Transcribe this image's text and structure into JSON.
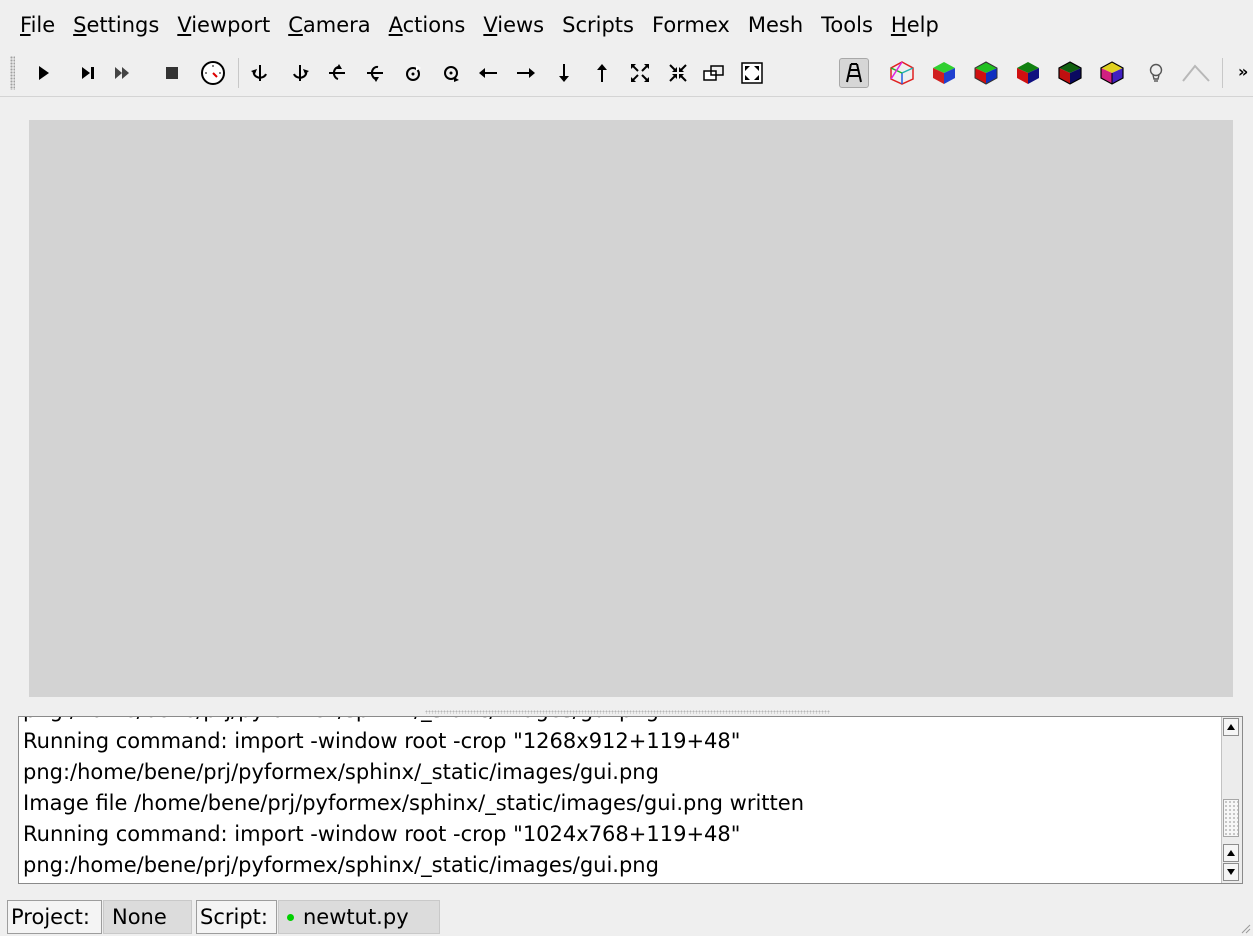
{
  "menubar": {
    "items": [
      {
        "first": "F",
        "rest": "ile"
      },
      {
        "first": "S",
        "rest": "ettings"
      },
      {
        "first": "V",
        "rest": "iewport"
      },
      {
        "first": "C",
        "rest": "amera"
      },
      {
        "first": "A",
        "rest": "ctions"
      },
      {
        "first": "V",
        "rest": "iews"
      },
      {
        "first": "",
        "rest": "Scripts"
      },
      {
        "first": "",
        "rest": "Formex"
      },
      {
        "first": "",
        "rest": "Mesh"
      },
      {
        "first": "",
        "rest": "Tools"
      },
      {
        "first": "H",
        "rest": "elp"
      }
    ]
  },
  "toolbar": {
    "icons": [
      "play-icon",
      "step-icon",
      "continue-icon",
      "stop-icon",
      "timer-icon",
      "rotate-left-icon",
      "rotate-right-icon",
      "rotate-up-icon",
      "rotate-down-icon",
      "rotate-ccw-icon",
      "rotate-cw-icon",
      "pan-left-icon",
      "pan-right-icon",
      "pan-down-icon",
      "pan-up-icon",
      "zoom-in-icon",
      "zoom-out-icon",
      "zoom-rectangle-icon",
      "zoom-all-icon",
      "perspective-icon",
      "wireframe-icon",
      "smooth-icon",
      "flat-icon",
      "smoothwire-icon",
      "flatwire-icon",
      "transparency-icon",
      "light-icon",
      "shrink-icon"
    ],
    "more_label": "»"
  },
  "messages": {
    "lines": [
      "png:/home/bene/prj/pyformex/sphinx/_static/images/gui.png",
      "Running command: import -window root -crop \"1268x912+119+48\"",
      "png:/home/bene/prj/pyformex/sphinx/_static/images/gui.png",
      "Image file /home/bene/prj/pyformex/sphinx/_static/images/gui.png written",
      "Running command: import -window root -crop \"1024x768+119+48\"",
      "png:/home/bene/prj/pyformex/sphinx/_static/images/gui.png"
    ]
  },
  "statusbar": {
    "project_label": "Project:",
    "project_value": "None",
    "script_label": "Script:",
    "script_value": "newtut.py",
    "script_status_color": "#00d000"
  }
}
